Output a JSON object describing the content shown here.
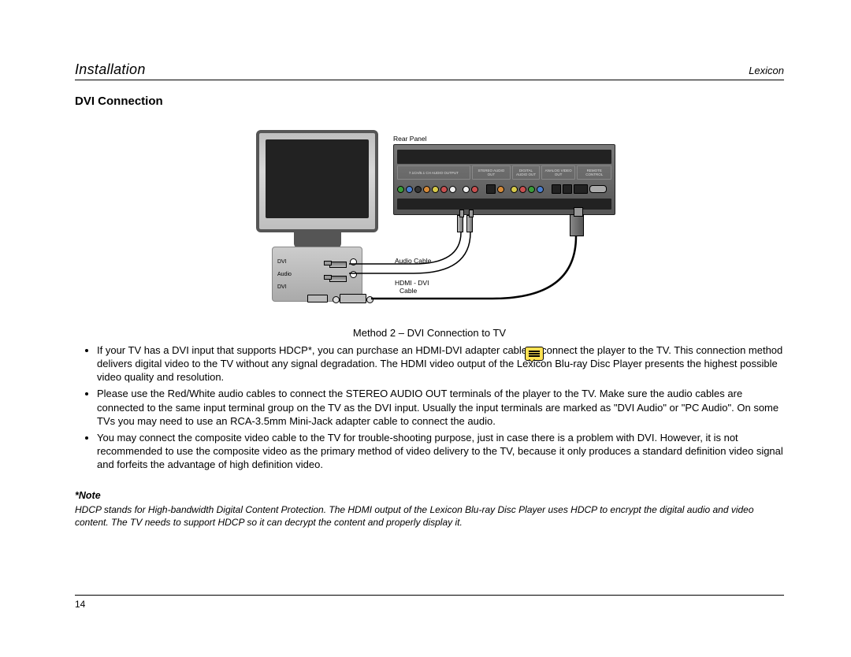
{
  "header": {
    "left": "Installation",
    "right": "Lexicon"
  },
  "section_title": "DVI Connection",
  "diagram": {
    "rear_panel_label": "Rear Panel",
    "tv_ports": {
      "dvi_audio_top": "DVI",
      "audio_mid": "Audio",
      "dvi_bottom": "DVI"
    },
    "rear_mid_labels": {
      "ch_audio": "7.1CH/5.1 CH AUDIO OUTPUT",
      "stereo": "STEREO AUDIO OUT",
      "dig_audio": "DIGITAL AUDIO OUT",
      "analog": "ANALOG VIDEO OUT",
      "remote": "REMOTE CONTROL"
    },
    "cable_labels": {
      "audio": "Audio Cable",
      "hdmi_dvi1": "HDMI - DVI",
      "hdmi_dvi2": "Cable"
    }
  },
  "caption": "Method 2 – DVI Connection to TV",
  "bullets": [
    "If your TV has a DVI input that supports HDCP*, you can purchase an HDMI-DVI adapter cable to connect the player to the TV. This connection method delivers digital video to the TV without any signal degradation. The HDMI video output of the Lexicon Blu-ray Disc Player presents the highest possible video quality and resolution.",
    "Please use the Red/White audio cables to connect the STEREO AUDIO OUT terminals of the player to the TV. Make sure the audio cables are connected to the same input terminal group on the TV as the DVI input. Usually the input terminals are marked as \"DVI Audio\" or \"PC Audio\". On some TVs you may need to use an RCA-3.5mm Mini-Jack adapter cable to connect the audio.",
    "You may connect the composite video cable to the TV for trouble-shooting purpose, just in case there is a problem with DVI. However, it is not recommended to use the composite video as the primary method of video delivery to the TV, because it only produces a standard definition video signal and forfeits the advantage of high definition video."
  ],
  "note": {
    "heading": "*Note",
    "body": "HDCP stands for High-bandwidth Digital Content Protection. The HDMI output of the Lexicon Blu-ray Disc Player uses HDCP to encrypt the digital audio and video content. The TV needs to support HDCP so it can decrypt the content and properly display it."
  },
  "page_number": "14"
}
